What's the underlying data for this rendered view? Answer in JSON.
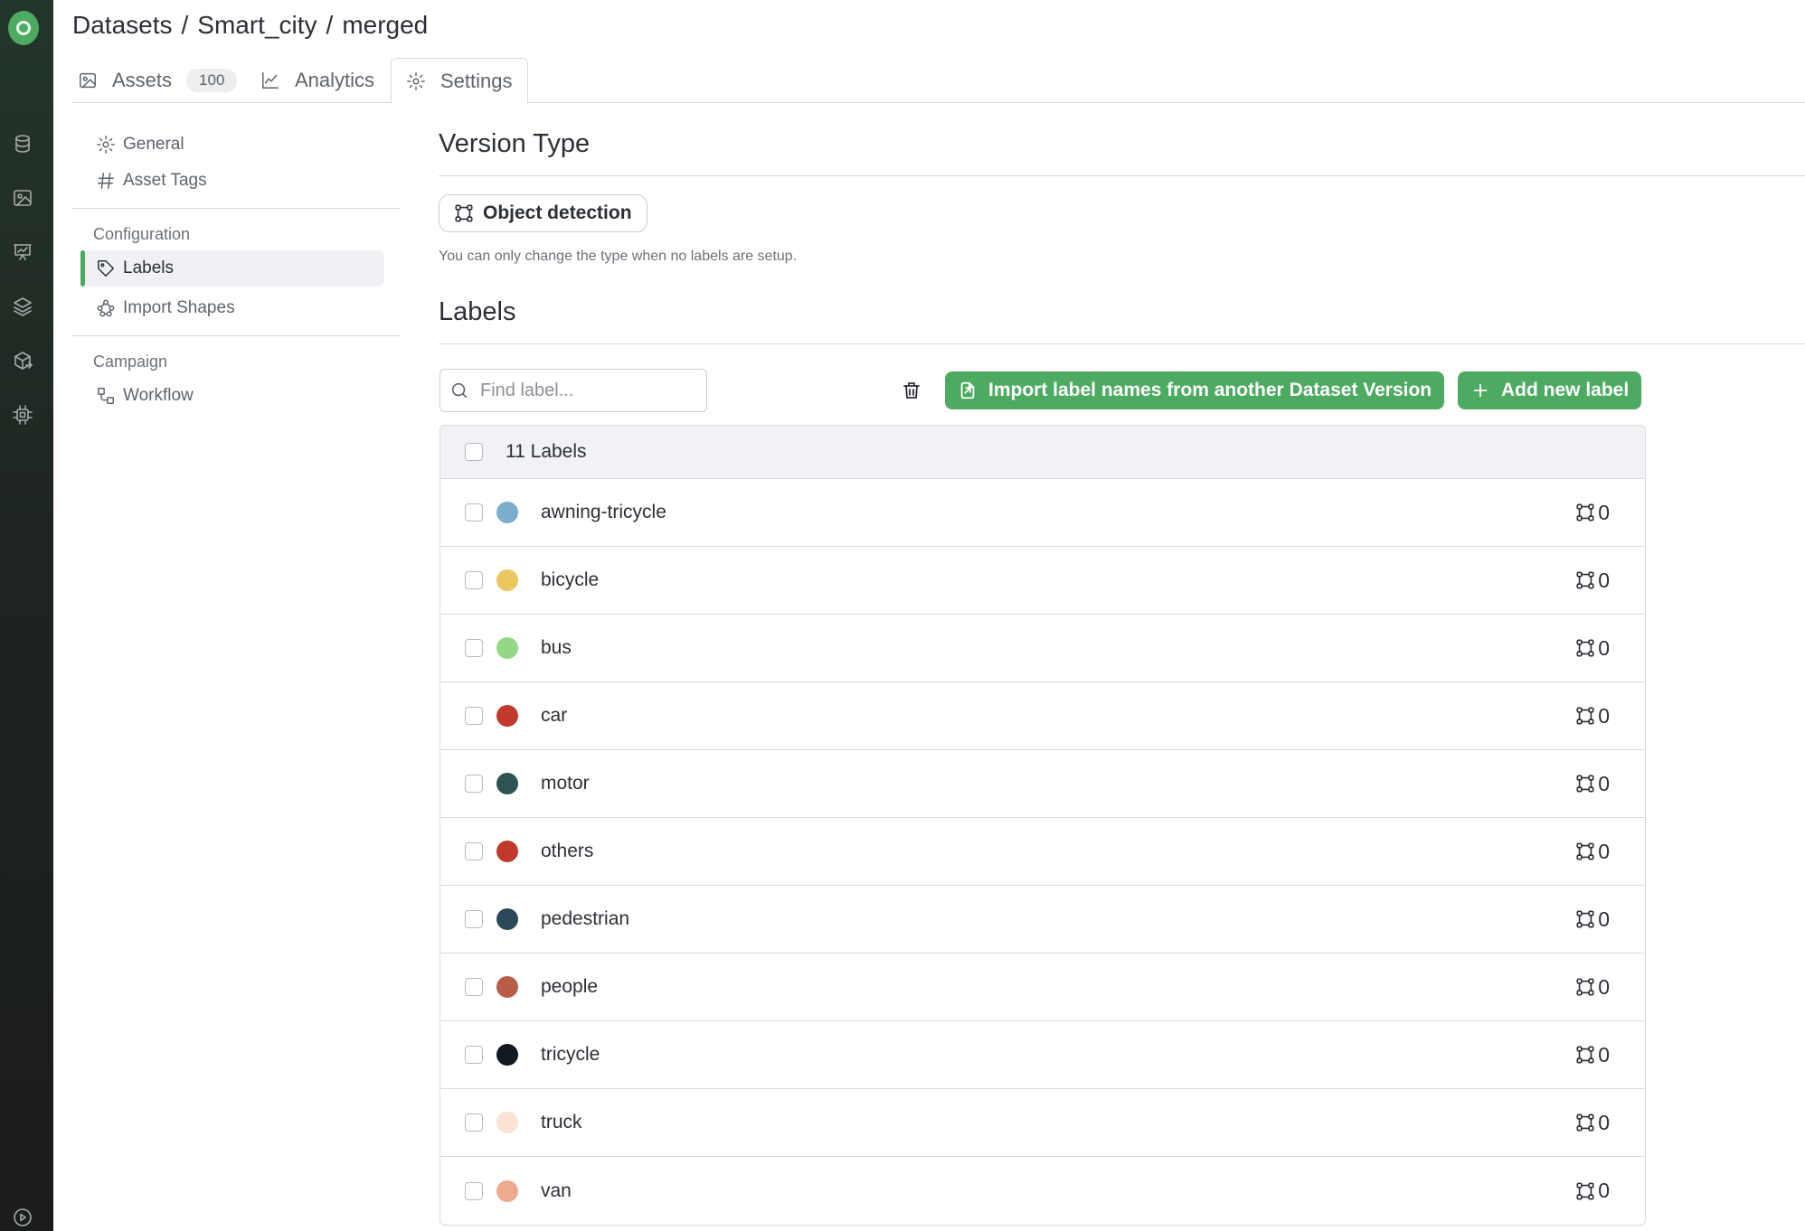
{
  "breadcrumb": [
    "Datasets",
    "Smart_city",
    "merged"
  ],
  "breadcrumb_separator": "/",
  "tabs": [
    {
      "label": "Assets",
      "count": "100",
      "icon": "image-icon"
    },
    {
      "label": "Analytics",
      "icon": "chart-line-icon"
    },
    {
      "label": "Settings",
      "icon": "gear-icon",
      "active": true
    }
  ],
  "settings_nav": {
    "general": "General",
    "asset_tags": "Asset Tags",
    "configuration_group": "Configuration",
    "labels": "Labels",
    "import_shapes": "Import Shapes",
    "campaign_group": "Campaign",
    "workflow": "Workflow"
  },
  "version_type": {
    "heading": "Version Type",
    "button_label": "Object detection",
    "hint": "You can only change the type when no labels are setup."
  },
  "labels_section": {
    "heading": "Labels",
    "search_placeholder": "Find label...",
    "import_button": "Import label names from another Dataset Version",
    "add_button": "Add new label",
    "count_label": "11 Labels"
  },
  "labels": [
    {
      "name": "awning-tricycle",
      "color": "#7aaecb",
      "count": "0"
    },
    {
      "name": "bicycle",
      "color": "#ecc65e",
      "count": "0"
    },
    {
      "name": "bus",
      "color": "#93d985",
      "count": "0"
    },
    {
      "name": "car",
      "color": "#c23a2b",
      "count": "0"
    },
    {
      "name": "motor",
      "color": "#2d5352",
      "count": "0"
    },
    {
      "name": "others",
      "color": "#c23a2b",
      "count": "0"
    },
    {
      "name": "pedestrian",
      "color": "#2d4858",
      "count": "0"
    },
    {
      "name": "people",
      "color": "#b95d4a",
      "count": "0"
    },
    {
      "name": "tricycle",
      "color": "#101820",
      "count": "0"
    },
    {
      "name": "truck",
      "color": "#fbe3d3",
      "count": "0"
    },
    {
      "name": "van",
      "color": "#eeaa8e",
      "count": "0"
    }
  ],
  "colors": {
    "accent": "#4caa61",
    "rail": "#1e2420"
  }
}
